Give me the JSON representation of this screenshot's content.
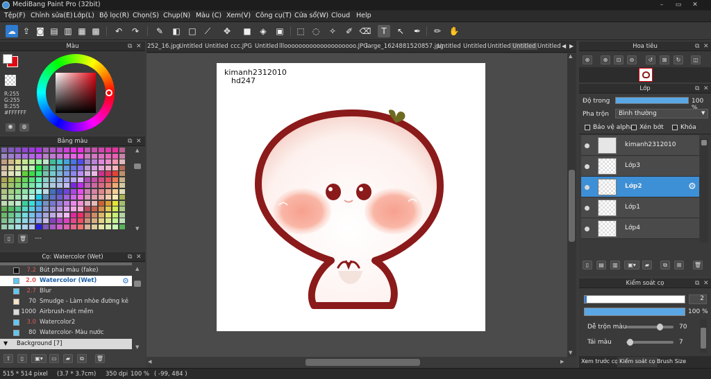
{
  "window": {
    "title": "MediBang Paint Pro (32bit)",
    "controls": [
      "–",
      "▭",
      "✕"
    ]
  },
  "menu": [
    "Tệp(F)",
    "Chỉnh sửa(E)",
    "Lớp(L)",
    "Bộ lọc(R)",
    "Chọn(S)",
    "Chụp(N)",
    "Màu (C)",
    "Xem(V)",
    "Công cụ(T)",
    "Cửa sổ(W)",
    "Cloud",
    "Help"
  ],
  "color_panel": {
    "title": "Màu",
    "r": "R:255",
    "g": "G:255",
    "b": "B:255",
    "hex": "#FFFFFF",
    "primary_color": "#e30613",
    "secondary_color": "#ffffff"
  },
  "palette_panel": {
    "title": "Bảng màu",
    "footer_text": "---"
  },
  "brush_panel": {
    "title": "Cọ: Watercolor (Wet)",
    "items": [
      {
        "size": "7.2",
        "name": "Bút phai màu (fake)",
        "color": "#111111"
      },
      {
        "size": "2.0",
        "name": "Watercolor (Wet)",
        "color": "#5fc7f0"
      },
      {
        "size": "2.7",
        "name": "Blur",
        "color": "#5fc7f0"
      },
      {
        "size": "70",
        "name": "Smudge - Làm nhòe đường kẻ",
        "color": "#f7e3c5"
      },
      {
        "size": "1000",
        "name": "Airbrush-nét mềm",
        "color": "#dddddd"
      },
      {
        "size": "3.0",
        "name": "Watercolor2",
        "color": "#5fc7f0"
      },
      {
        "size": "80",
        "name": "Watercolor- Màu nước",
        "color": "#5fc7f0"
      }
    ],
    "group": "Background [7]"
  },
  "tabs": [
    "252_16.jpg",
    "Untitled",
    "Untitled",
    "ccc.JPG",
    "Untitled",
    "llloooooooooooooooooooo.JPG",
    "large_1624881520857.jpg",
    "Untitled",
    "Untitled",
    "Untitled",
    "Untitled",
    "Untitled"
  ],
  "canvas": {
    "text_line1": "kimanh2312010",
    "text_line2": "hd247"
  },
  "navigator_panel": {
    "title": "Hoa tiêu"
  },
  "layer_panel": {
    "title": "Lớp",
    "opacity_label": "Độ trong",
    "opacity_value": "100 %",
    "blend_label": "Pha trộn",
    "blend_value": "Bình thường",
    "protect_alpha": "Bảo vệ alpha",
    "clipping": "Xén bớt",
    "lock": "Khóa",
    "layers": [
      {
        "name": "kimanh2312010",
        "selected": false
      },
      {
        "name": "Lớp3",
        "selected": false
      },
      {
        "name": "Lớp2",
        "selected": true
      },
      {
        "name": "Lớp1",
        "selected": false
      },
      {
        "name": "Lớp4",
        "selected": false
      }
    ]
  },
  "brush_control": {
    "title": "Kiểm soát cọ",
    "size_value": "2",
    "opacity_value": "100 %",
    "opacity_fraction": 1.0,
    "mix_label": "Dễ trộn màu",
    "mix_value": "70",
    "mix_fraction": 0.7,
    "paint_label": "Tái màu",
    "paint_value": "7",
    "paint_fraction": 0.07,
    "tabs": [
      "Xem trước cọ",
      "Kiểm soát cọ",
      "Brush Size"
    ]
  },
  "status": {
    "size": "515 * 514 pixel",
    "cm": "(3.7 * 3.7cm)",
    "dpi": "350 dpi",
    "zoom": "100 %",
    "cursor": "( -99, 484 )"
  },
  "icons": [
    "color-wheel-icon",
    "undo-icon",
    "redo-icon",
    "brush-icon",
    "eraser-icon",
    "move-icon",
    "fill-icon",
    "text-icon",
    "hand-icon",
    "eye-icon",
    "gear-icon",
    "trash-icon"
  ],
  "colors": {
    "accent": "#2e7bd0",
    "selected_layer": "#3d8fd6",
    "outline_red": "#8b1a1a"
  }
}
